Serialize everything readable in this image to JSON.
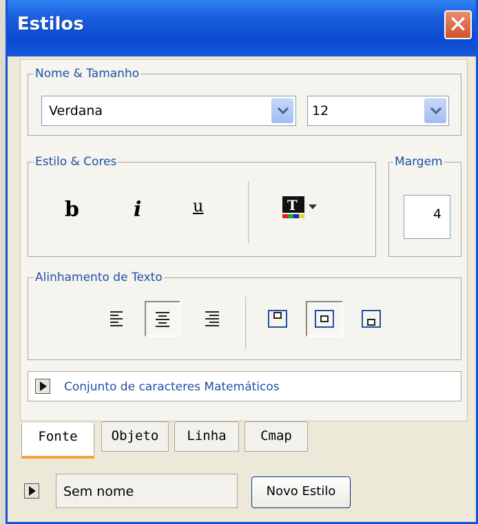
{
  "window": {
    "title": "Estilos",
    "close_glyph": "✕"
  },
  "name_size": {
    "legend": "Nome & Tamanho",
    "font_value": "Verdana",
    "size_value": "12"
  },
  "style_colors": {
    "legend": "Estilo & Cores",
    "bold_label": "b",
    "italic_label": "i",
    "underline_label": "u",
    "color_icon": "text-color-icon"
  },
  "margin": {
    "legend": "Margem",
    "value": "4"
  },
  "alignment": {
    "legend": "Alinhamento de Texto"
  },
  "math": {
    "label": "Conjunto de caracteres Matemáticos"
  },
  "tabs": [
    {
      "label": "Fonte",
      "active": true
    },
    {
      "label": "Objeto"
    },
    {
      "label": "Linha"
    },
    {
      "label": "Cmap"
    }
  ],
  "footer": {
    "style_name": "Sem nome",
    "new_style_label": "Novo Estilo"
  },
  "colors": {
    "titlebar": "#0a4bd2",
    "accent_tab": "#f5a331",
    "legend_text": "#1e4fa8"
  }
}
